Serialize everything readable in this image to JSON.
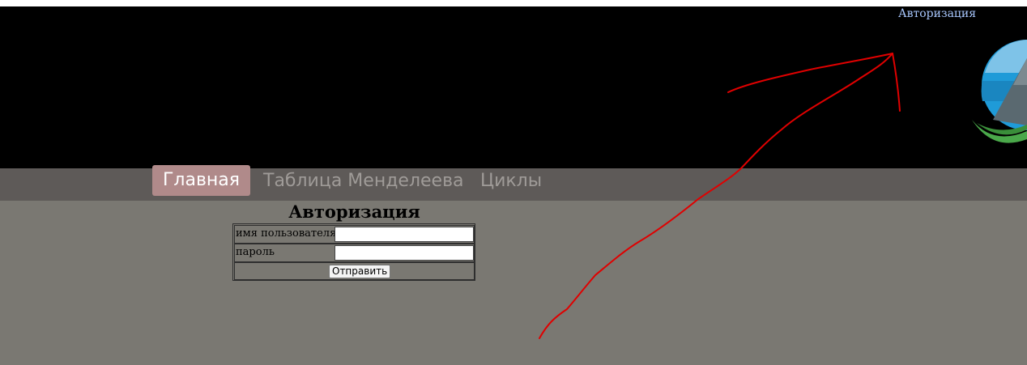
{
  "header": {
    "auth_link": "Авторизация",
    "logo_colors": {
      "sky": "#7ec3e8",
      "blue": "#1f9bd8",
      "mountain": "#5a6970",
      "grass": "#4aa84a"
    }
  },
  "nav": {
    "items": [
      {
        "label": "Главная",
        "active": true
      },
      {
        "label": "Таблица Менделеева",
        "active": false
      },
      {
        "label": "Циклы",
        "active": false
      }
    ]
  },
  "form": {
    "title": "Авторизация",
    "username_label": "имя пользователя",
    "username_value": "",
    "password_label": "пароль",
    "password_value": "",
    "submit_label": "Отправить"
  },
  "colors": {
    "page_bg": "#7a7872",
    "header_bg": "#000000",
    "nav_bg": "#5e5a58",
    "nav_active_bg": "#b08a8a",
    "annotation": "#e00000"
  }
}
